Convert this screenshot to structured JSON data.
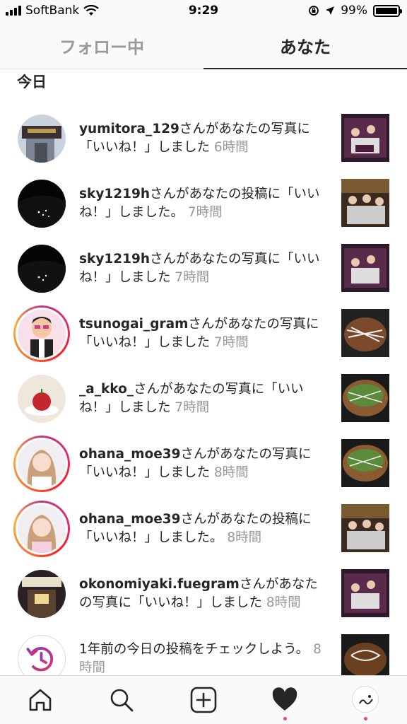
{
  "status": {
    "carrier": "SoftBank",
    "time": "9:29",
    "battery": "99%",
    "battery_level": 0.99
  },
  "tabs": [
    {
      "label": "フォロー中"
    },
    {
      "label": "あなた"
    }
  ],
  "section": "今日",
  "items": [
    {
      "user": "yumitora_129",
      "msg": "さんがあなたの写真に「いいね！」しました",
      "time": "6時間"
    },
    {
      "user": "sky1219h",
      "msg": "さんがあなたの投稿に「いいね！」しました。",
      "time": "7時間"
    },
    {
      "user": "sky1219h",
      "msg": "さんがあなたの写真に「いいね！」しました",
      "time": "7時間"
    },
    {
      "user": "tsunogai_gram",
      "msg": "さんがあなたの写真に「いいね！」しました",
      "time": "7時間"
    },
    {
      "user": "_a_kko_",
      "msg": "さんがあなたの写真に「いいね！」しました",
      "time": "7時間"
    },
    {
      "user": "ohana_moe39",
      "msg": "さんがあなたの写真に「いいね！」しました",
      "time": "8時間"
    },
    {
      "user": "ohana_moe39",
      "msg": "さんがあなたの投稿に「いいね！」しました。",
      "time": "8時間"
    },
    {
      "user": "okonomiyaki.fuegram",
      "msg": "さんがあなたの写真に「いいね！」しました",
      "time": "8時間"
    },
    {
      "user": "",
      "msg": "1年前の今日の投稿をチェックしよう。",
      "time": "8時間"
    }
  ],
  "nav": {
    "icons": [
      "home-icon",
      "search-icon",
      "new-post-icon",
      "activity-heart-icon",
      "profile-avatar"
    ]
  },
  "colors": {
    "accent": "#262626",
    "secondary": "#999999",
    "badge": "#ed4956"
  }
}
